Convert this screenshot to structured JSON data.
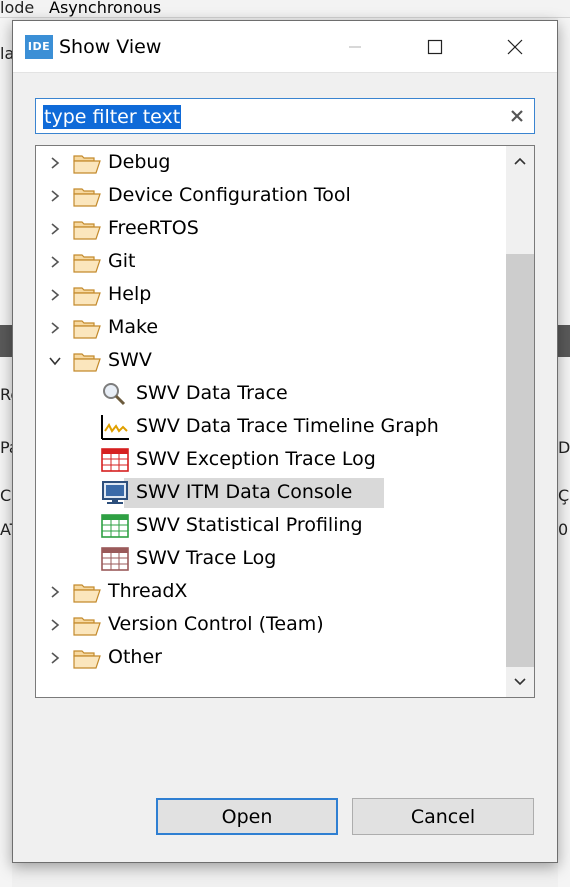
{
  "background": {
    "mode_fragment": "lode",
    "async_label": "Asynchronous",
    "fragments": [
      "la",
      "Re",
      "Pa",
      "D",
      "C",
      "Ç",
      "AT",
      "0"
    ]
  },
  "dialog": {
    "app_icon_text": "IDE",
    "title": "Show View",
    "filter": {
      "value": "type filter text"
    },
    "tree": [
      {
        "label": "Debug",
        "icon": "folder-icon",
        "expanded": false,
        "level": 0
      },
      {
        "label": "Device Configuration Tool",
        "icon": "folder-icon",
        "expanded": false,
        "level": 0
      },
      {
        "label": "FreeRTOS",
        "icon": "folder-icon",
        "expanded": false,
        "level": 0
      },
      {
        "label": "Git",
        "icon": "folder-icon",
        "expanded": false,
        "level": 0
      },
      {
        "label": "Help",
        "icon": "folder-icon",
        "expanded": false,
        "level": 0
      },
      {
        "label": "Make",
        "icon": "folder-icon",
        "expanded": false,
        "level": 0
      },
      {
        "label": "SWV",
        "icon": "folder-icon",
        "expanded": true,
        "level": 0
      },
      {
        "label": "SWV Data Trace",
        "icon": "magnifier-icon",
        "level": 1
      },
      {
        "label": "SWV Data Trace Timeline Graph",
        "icon": "timeline-graph-icon",
        "level": 1
      },
      {
        "label": "SWV Exception Trace Log",
        "icon": "red-table-icon",
        "level": 1
      },
      {
        "label": "SWV ITM Data Console",
        "icon": "console-monitor-icon",
        "level": 1,
        "selected": true
      },
      {
        "label": "SWV Statistical Profiling",
        "icon": "green-table-icon",
        "level": 1
      },
      {
        "label": "SWV Trace Log",
        "icon": "brown-table-icon",
        "level": 1
      },
      {
        "label": "ThreadX",
        "icon": "folder-icon",
        "expanded": false,
        "level": 0
      },
      {
        "label": "Version Control (Team)",
        "icon": "folder-icon",
        "expanded": false,
        "level": 0
      },
      {
        "label": "Other",
        "icon": "folder-icon",
        "expanded": false,
        "level": 0
      }
    ],
    "buttons": {
      "open_label": "Open",
      "cancel_label": "Cancel"
    },
    "colors": {
      "accent": "#0f6ad8",
      "selection": "#d9d9d9",
      "folder_fill": "#f7d9a1",
      "folder_stroke": "#c38a2c"
    }
  }
}
